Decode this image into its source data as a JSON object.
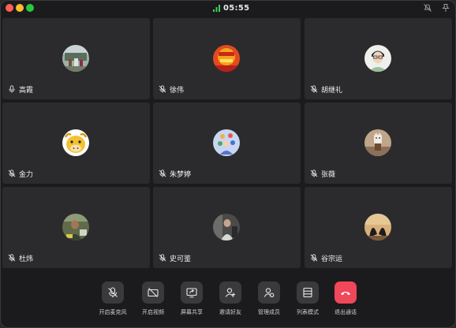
{
  "titlebar": {
    "call_duration": "05:55"
  },
  "participants": [
    {
      "name": "高霞",
      "mic": "on"
    },
    {
      "name": "徐伟",
      "mic": "muted"
    },
    {
      "name": "胡继礼",
      "mic": "muted"
    },
    {
      "name": "金力",
      "mic": "muted"
    },
    {
      "name": "朱梦婷",
      "mic": "muted"
    },
    {
      "name": "张薇",
      "mic": "muted"
    },
    {
      "name": "杜炜",
      "mic": "muted"
    },
    {
      "name": "史可鉴",
      "mic": "muted"
    },
    {
      "name": "谷宗运",
      "mic": "muted"
    }
  ],
  "controls": {
    "mic": "开启麦克风",
    "video": "开启视频",
    "share": "屏幕共享",
    "invite": "邀请好友",
    "manage": "管理成员",
    "list_mode": "列表模式",
    "leave": "退出通话"
  },
  "colors": {
    "hangup": "#f0475a",
    "signal": "#3ecf5c",
    "tile_bg": "#2b2b2d"
  }
}
